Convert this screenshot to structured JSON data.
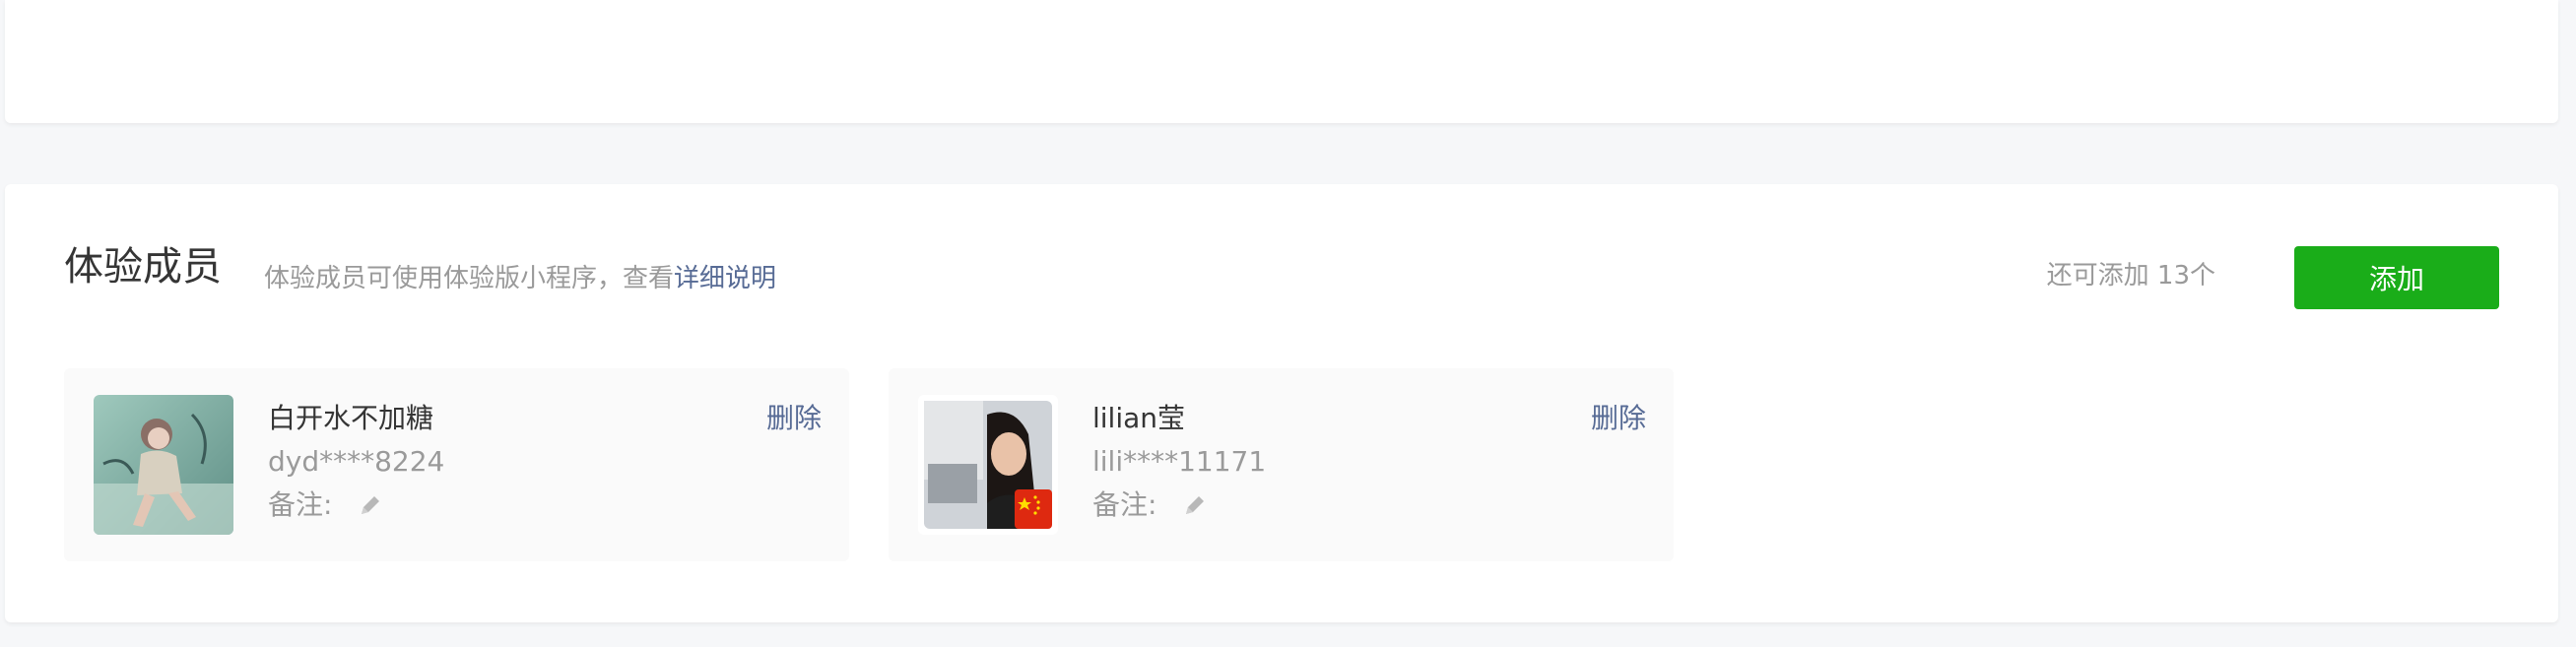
{
  "section": {
    "title": "体验成员",
    "description": "体验成员可使用体验版小程序，查看",
    "description_link": "详细说明",
    "quota_text": "还可添加 13个",
    "add_button_label": "添加"
  },
  "members": [
    {
      "name": "白开水不加糖",
      "id": "dyd****8224",
      "remark_label": "备注:",
      "delete_label": "删除",
      "avatar_icon": "avatar-illustration"
    },
    {
      "name": "lilian莹",
      "id": "lili****11171",
      "remark_label": "备注:",
      "delete_label": "删除",
      "avatar_icon": "avatar-photo"
    }
  ],
  "colors": {
    "accent_green": "#1aad19",
    "link_blue": "#576b95",
    "text_primary": "#353535",
    "text_secondary": "#9a9a9a",
    "page_bg": "#f6f7f9"
  }
}
